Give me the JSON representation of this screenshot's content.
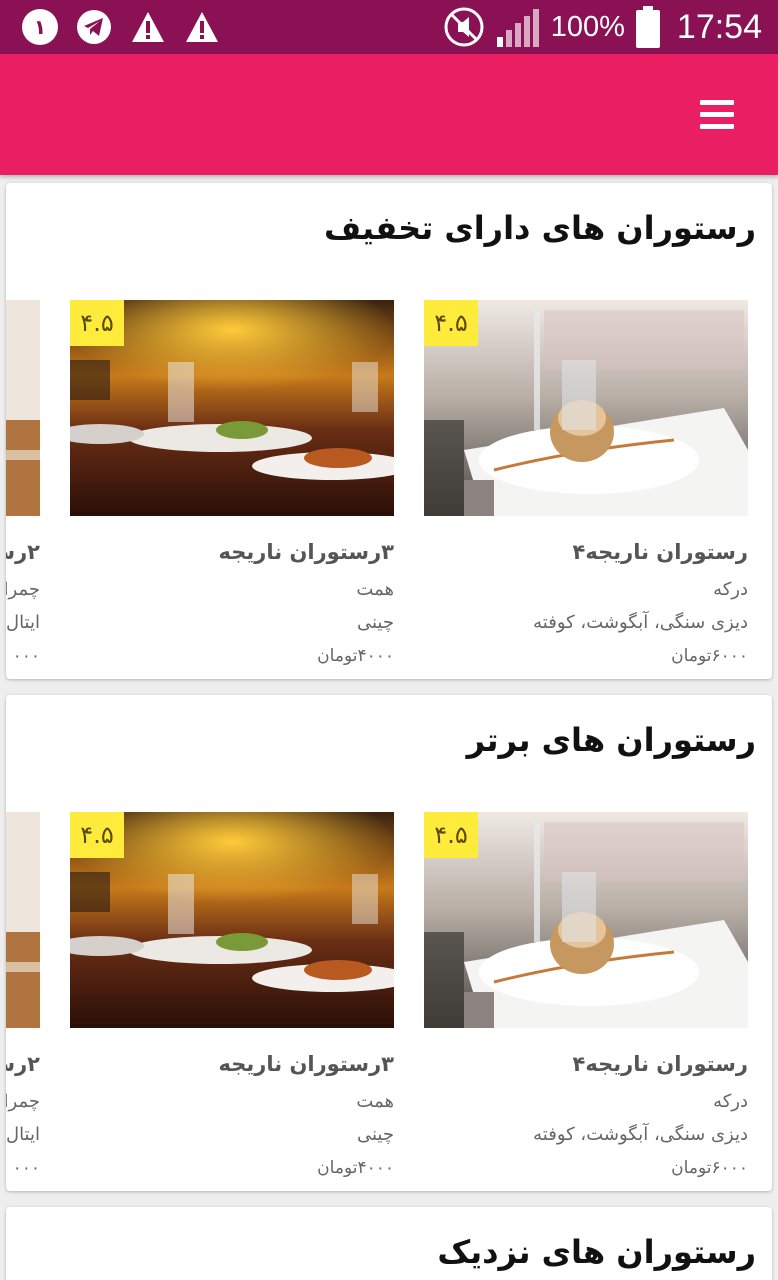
{
  "status_bar": {
    "notification_badge": "١",
    "battery_text": "100%",
    "time": "17:54",
    "icons": [
      "badge-one-icon",
      "telegram-icon",
      "warning-icon",
      "warning-icon",
      "mute-icon",
      "signal-icon",
      "battery-icon"
    ]
  },
  "app_bar": {
    "icon": "menu-icon",
    "color": "#e91e63"
  },
  "sections": [
    {
      "title": "رستوران های دارای تخفیف",
      "cards": [
        {
          "rating": "۴.۵",
          "name": "رستوران ناریجه۴",
          "area": "درکه",
          "foods": "دیزی سنگی، آبگوشت، کوفته",
          "price": "۶۰۰۰تومان"
        },
        {
          "rating": "۴.۵",
          "name": "۳رستوران ناریجه",
          "area": "همت",
          "foods": "چینی",
          "price": "۴۰۰۰تومان"
        },
        {
          "rating": "",
          "name": "۲رس",
          "area": "چمرا",
          "foods": "ایتال",
          "price": "۰۰۰"
        }
      ]
    },
    {
      "title": "رستوران های برتر",
      "cards": [
        {
          "rating": "۴.۵",
          "name": "رستوران ناریجه۴",
          "area": "درکه",
          "foods": "دیزی سنگی، آبگوشت، کوفته",
          "price": "۶۰۰۰تومان"
        },
        {
          "rating": "۴.۵",
          "name": "۳رستوران ناریجه",
          "area": "همت",
          "foods": "چینی",
          "price": "۴۰۰۰تومان"
        },
        {
          "rating": "",
          "name": "۲رس",
          "area": "چمرا",
          "foods": "ایتال",
          "price": "۰۰۰"
        }
      ]
    },
    {
      "title": "رستوران های نزدیک"
    }
  ],
  "colors": {
    "status_bar": "#8a1254",
    "accent": "#e91e63",
    "rating_badge": "#ffeb3b"
  }
}
